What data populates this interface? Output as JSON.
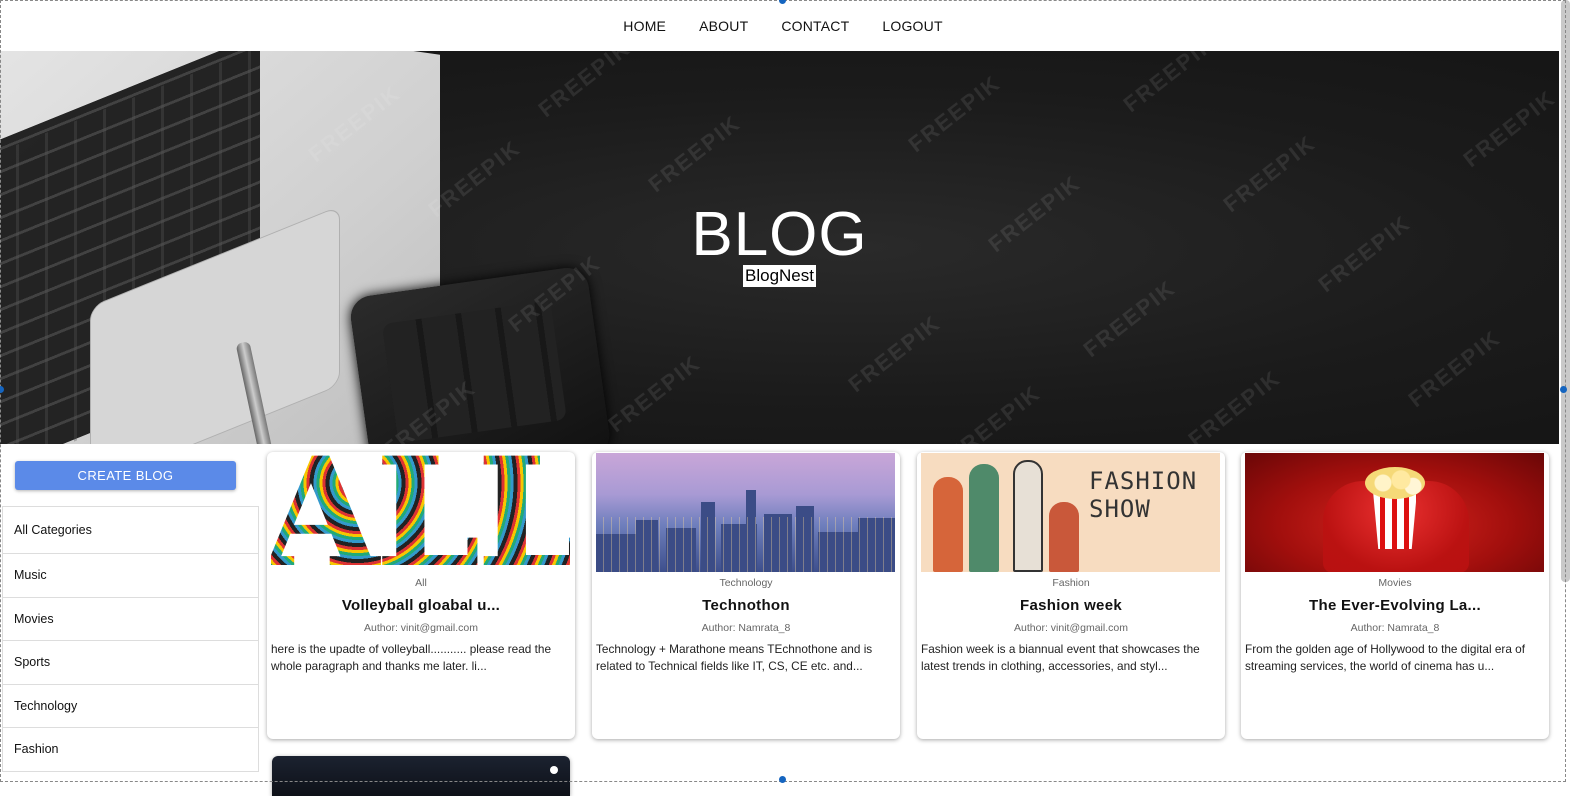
{
  "nav": {
    "items": [
      "HOME",
      "ABOUT",
      "CONTACT",
      "LOGOUT"
    ]
  },
  "hero": {
    "title": "BLOG",
    "subtitle": "BlogNest",
    "watermark": "FREEPIK"
  },
  "sidebar": {
    "create_button": "CREATE BLOG",
    "categories": [
      "All Categories",
      "Music",
      "Movies",
      "Sports",
      "Technology",
      "Fashion"
    ]
  },
  "posts": [
    {
      "category": "All",
      "title": "Volleyball gloabal u...",
      "author": "Author: vinit@gmail.com",
      "description": "here is the upadte of volleyball........... please read the whole paragraph and thanks me later. li...",
      "image_text": "ALL"
    },
    {
      "category": "Technology",
      "title": "Technothon",
      "author": "Author: Namrata_8",
      "description": "Technology + Marathone means TEchnothone and is related to Technical fields like IT, CS, CE etc. and..."
    },
    {
      "category": "Fashion",
      "title": "Fashion week",
      "author": "Author: vinit@gmail.com",
      "description": "Fashion week is a biannual event that showcases the latest trends in clothing, accessories, and styl...",
      "image_text_1": "FASHION",
      "image_text_2": "SHOW"
    },
    {
      "category": "Movies",
      "title": "The Ever-Evolving La...",
      "author": "Author: Namrata_8",
      "description": "From the golden age of Hollywood to the digital era of streaming services, the world of cinema has u..."
    }
  ],
  "colors": {
    "accent": "#5b8ae8",
    "hero_bg": "#1b1b1b",
    "handle": "#1565c0"
  }
}
